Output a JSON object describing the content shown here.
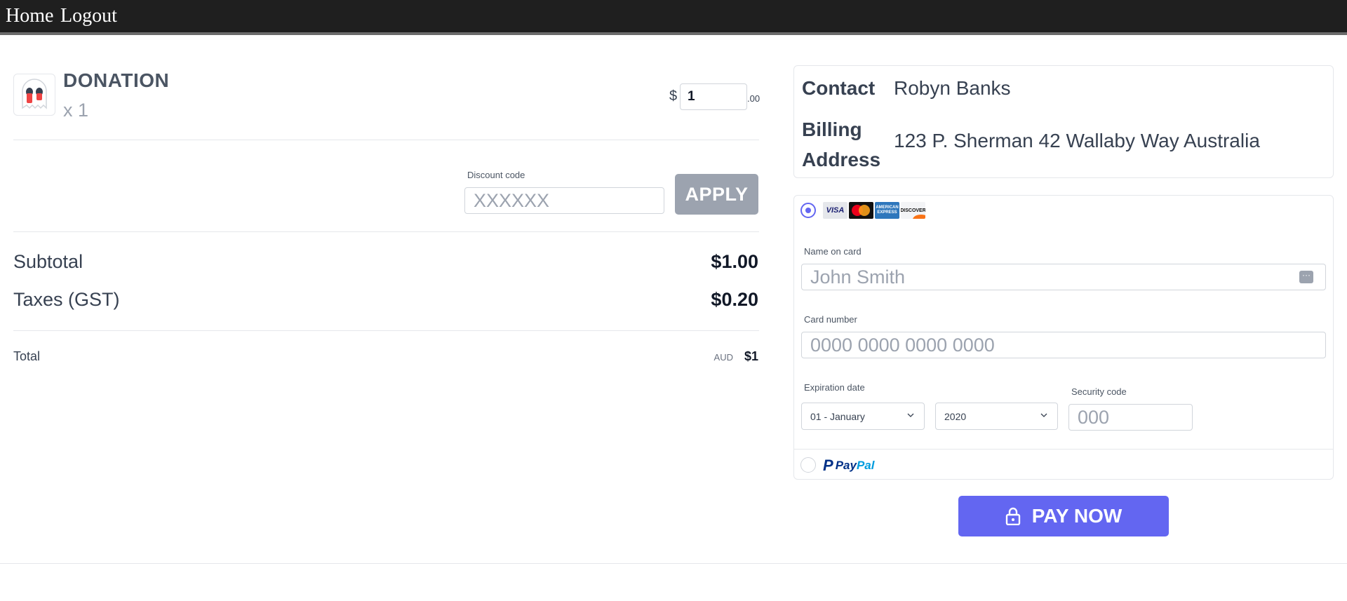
{
  "nav": {
    "home": "Home",
    "logout": "Logout"
  },
  "product": {
    "icon": "ghost-icon",
    "name": "DONATION",
    "quantity": "x 1",
    "currency_symbol": "$",
    "amount": "1",
    "cents": ".00"
  },
  "discount": {
    "label": "Discount code",
    "placeholder": "XXXXXX",
    "apply_label": "APPLY"
  },
  "summary": {
    "subtotal_label": "Subtotal",
    "subtotal_value": "$1.00",
    "tax_label": "Taxes (GST)",
    "tax_value": "$0.20",
    "total_label": "Total",
    "total_currency": "AUD",
    "total_value": "$1"
  },
  "contact": {
    "contact_label": "Contact",
    "contact_value": "Robyn Banks",
    "billing_label": "Billing Address",
    "billing_value": "123 P. Sherman 42 Wallaby Way Australia"
  },
  "payment": {
    "card_logos": [
      {
        "name": "visa",
        "text": "VISA"
      },
      {
        "name": "mastercard",
        "text": ""
      },
      {
        "name": "amex",
        "text": "AMERICAN EXPRESS"
      },
      {
        "name": "discover",
        "text": "DISCOVER"
      }
    ],
    "name_label": "Name on card",
    "name_placeholder": "John Smith",
    "card_label": "Card number",
    "card_placeholder": "0000 0000 0000 0000",
    "expiration_label": "Expiration date",
    "month_value": "01 - January",
    "year_value": "2020",
    "security_label": "Security code",
    "security_placeholder": "000",
    "paypal_pay": "Pay",
    "paypal_pal": "Pal",
    "card_selected": true
  },
  "pay_button_label": "PAY NOW",
  "colors": {
    "accent": "#6366f1",
    "apply_disabled": "#9ca3af",
    "nav_bg": "#1f1f1f"
  }
}
